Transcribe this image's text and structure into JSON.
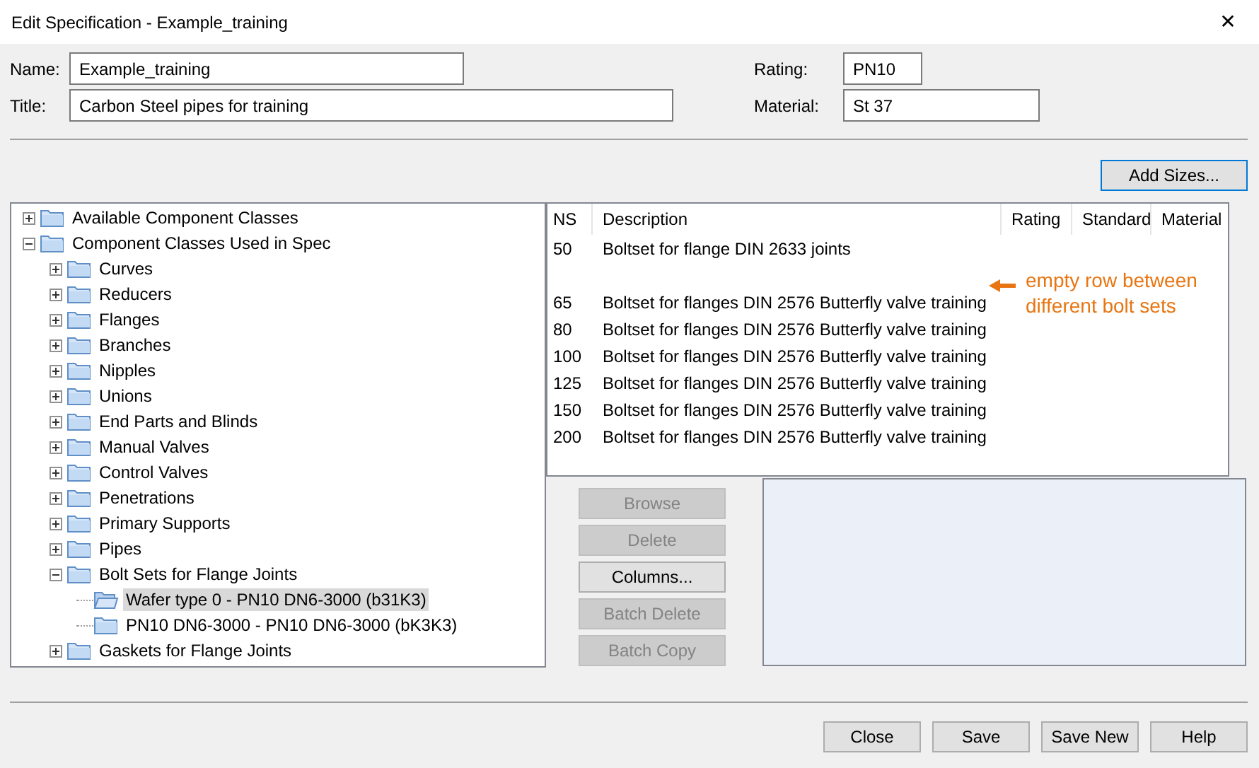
{
  "window": {
    "title": "Edit Specification - Example_training",
    "close": "✕"
  },
  "fields": [
    {
      "label": "Name:",
      "value": "Example_training",
      "kind": "wide"
    },
    {
      "label": "Title:",
      "value": "Carbon Steel pipes for training",
      "kind": "wide"
    },
    {
      "label": "Rating:",
      "value": "PN10",
      "kind": "short"
    },
    {
      "label": "Material:",
      "value": "St 37",
      "kind": "medium"
    }
  ],
  "add_sizes_button": "Add Sizes...",
  "tree": [
    {
      "label": "Available Component Classes",
      "expanded": false,
      "selected": false
    },
    {
      "label": "Component Classes Used in Spec",
      "expanded": true,
      "selected": false,
      "children": [
        {
          "label": "Curves",
          "expanded": false,
          "selected": false
        },
        {
          "label": "Reducers",
          "expanded": false,
          "selected": false
        },
        {
          "label": "Flanges",
          "expanded": false,
          "selected": false
        },
        {
          "label": "Branches",
          "expanded": false,
          "selected": false
        },
        {
          "label": "Nipples",
          "expanded": false,
          "selected": false
        },
        {
          "label": "Unions",
          "expanded": false,
          "selected": false
        },
        {
          "label": "End Parts and Blinds",
          "expanded": false,
          "selected": false
        },
        {
          "label": "Manual Valves",
          "expanded": false,
          "selected": false
        },
        {
          "label": "Control Valves",
          "expanded": false,
          "selected": false
        },
        {
          "label": "Penetrations",
          "expanded": false,
          "selected": false
        },
        {
          "label": "Primary Supports",
          "expanded": false,
          "selected": false
        },
        {
          "label": "Pipes",
          "expanded": false,
          "selected": false
        },
        {
          "label": "Bolt Sets for Flange Joints",
          "expanded": true,
          "selected": false,
          "children": [
            {
              "label": "Wafer type 0 - PN10 DN6-3000 (b31K3)",
              "selected": true
            },
            {
              "label": "PN10 DN6-3000 - PN10 DN6-3000 (bK3K3)",
              "selected": false
            }
          ]
        },
        {
          "label": "Gaskets for Flange Joints",
          "expanded": false,
          "selected": false
        }
      ]
    }
  ],
  "table": {
    "columns": [
      "NS",
      "Description",
      "Rating",
      "Standard",
      "Material"
    ],
    "rows": [
      {
        "kind": "data",
        "ns": "50",
        "description": "Boltset for flange DIN 2633 joints"
      },
      {
        "kind": "blank"
      },
      {
        "kind": "data",
        "ns": "65",
        "description": "Boltset for flanges DIN 2576 Butterfly valve training"
      },
      {
        "kind": "data",
        "ns": "80",
        "description": "Boltset for flanges DIN 2576 Butterfly valve training"
      },
      {
        "kind": "data",
        "ns": "100",
        "description": "Boltset for flanges DIN 2576 Butterfly valve training"
      },
      {
        "kind": "data",
        "ns": "125",
        "description": "Boltset for flanges DIN 2576 Butterfly valve training"
      },
      {
        "kind": "data",
        "ns": "150",
        "description": "Boltset for flanges DIN 2576 Butterfly valve training"
      },
      {
        "kind": "data",
        "ns": "200",
        "description": "Boltset for flanges DIN 2576 Butterfly valve training"
      }
    ]
  },
  "annotation": "empty row between different bolt sets",
  "side_buttons": [
    {
      "label": "Browse",
      "disabled": true
    },
    {
      "label": "Delete",
      "disabled": true
    },
    {
      "label": "Columns...",
      "disabled": false
    },
    {
      "label": "Batch Delete",
      "disabled": true
    },
    {
      "label": "Batch Copy",
      "disabled": true
    }
  ],
  "footer_buttons": [
    "Close",
    "Save",
    "Save New",
    "Help"
  ]
}
